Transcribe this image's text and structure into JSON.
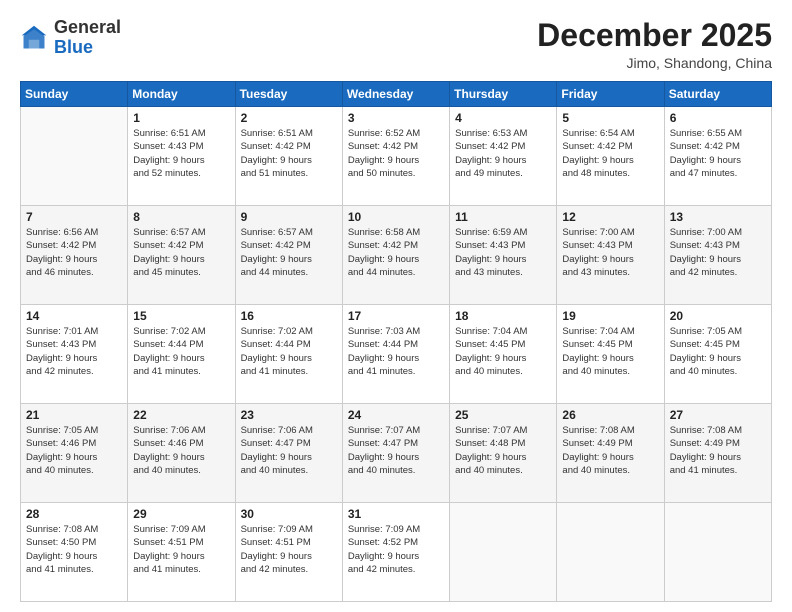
{
  "logo": {
    "general": "General",
    "blue": "Blue"
  },
  "header": {
    "month": "December 2025",
    "location": "Jimo, Shandong, China"
  },
  "weekdays": [
    "Sunday",
    "Monday",
    "Tuesday",
    "Wednesday",
    "Thursday",
    "Friday",
    "Saturday"
  ],
  "weeks": [
    [
      {
        "day": "",
        "info": ""
      },
      {
        "day": "1",
        "info": "Sunrise: 6:51 AM\nSunset: 4:43 PM\nDaylight: 9 hours\nand 52 minutes."
      },
      {
        "day": "2",
        "info": "Sunrise: 6:51 AM\nSunset: 4:42 PM\nDaylight: 9 hours\nand 51 minutes."
      },
      {
        "day": "3",
        "info": "Sunrise: 6:52 AM\nSunset: 4:42 PM\nDaylight: 9 hours\nand 50 minutes."
      },
      {
        "day": "4",
        "info": "Sunrise: 6:53 AM\nSunset: 4:42 PM\nDaylight: 9 hours\nand 49 minutes."
      },
      {
        "day": "5",
        "info": "Sunrise: 6:54 AM\nSunset: 4:42 PM\nDaylight: 9 hours\nand 48 minutes."
      },
      {
        "day": "6",
        "info": "Sunrise: 6:55 AM\nSunset: 4:42 PM\nDaylight: 9 hours\nand 47 minutes."
      }
    ],
    [
      {
        "day": "7",
        "info": "Sunrise: 6:56 AM\nSunset: 4:42 PM\nDaylight: 9 hours\nand 46 minutes."
      },
      {
        "day": "8",
        "info": "Sunrise: 6:57 AM\nSunset: 4:42 PM\nDaylight: 9 hours\nand 45 minutes."
      },
      {
        "day": "9",
        "info": "Sunrise: 6:57 AM\nSunset: 4:42 PM\nDaylight: 9 hours\nand 44 minutes."
      },
      {
        "day": "10",
        "info": "Sunrise: 6:58 AM\nSunset: 4:42 PM\nDaylight: 9 hours\nand 44 minutes."
      },
      {
        "day": "11",
        "info": "Sunrise: 6:59 AM\nSunset: 4:43 PM\nDaylight: 9 hours\nand 43 minutes."
      },
      {
        "day": "12",
        "info": "Sunrise: 7:00 AM\nSunset: 4:43 PM\nDaylight: 9 hours\nand 43 minutes."
      },
      {
        "day": "13",
        "info": "Sunrise: 7:00 AM\nSunset: 4:43 PM\nDaylight: 9 hours\nand 42 minutes."
      }
    ],
    [
      {
        "day": "14",
        "info": "Sunrise: 7:01 AM\nSunset: 4:43 PM\nDaylight: 9 hours\nand 42 minutes."
      },
      {
        "day": "15",
        "info": "Sunrise: 7:02 AM\nSunset: 4:44 PM\nDaylight: 9 hours\nand 41 minutes."
      },
      {
        "day": "16",
        "info": "Sunrise: 7:02 AM\nSunset: 4:44 PM\nDaylight: 9 hours\nand 41 minutes."
      },
      {
        "day": "17",
        "info": "Sunrise: 7:03 AM\nSunset: 4:44 PM\nDaylight: 9 hours\nand 41 minutes."
      },
      {
        "day": "18",
        "info": "Sunrise: 7:04 AM\nSunset: 4:45 PM\nDaylight: 9 hours\nand 40 minutes."
      },
      {
        "day": "19",
        "info": "Sunrise: 7:04 AM\nSunset: 4:45 PM\nDaylight: 9 hours\nand 40 minutes."
      },
      {
        "day": "20",
        "info": "Sunrise: 7:05 AM\nSunset: 4:45 PM\nDaylight: 9 hours\nand 40 minutes."
      }
    ],
    [
      {
        "day": "21",
        "info": "Sunrise: 7:05 AM\nSunset: 4:46 PM\nDaylight: 9 hours\nand 40 minutes."
      },
      {
        "day": "22",
        "info": "Sunrise: 7:06 AM\nSunset: 4:46 PM\nDaylight: 9 hours\nand 40 minutes."
      },
      {
        "day": "23",
        "info": "Sunrise: 7:06 AM\nSunset: 4:47 PM\nDaylight: 9 hours\nand 40 minutes."
      },
      {
        "day": "24",
        "info": "Sunrise: 7:07 AM\nSunset: 4:47 PM\nDaylight: 9 hours\nand 40 minutes."
      },
      {
        "day": "25",
        "info": "Sunrise: 7:07 AM\nSunset: 4:48 PM\nDaylight: 9 hours\nand 40 minutes."
      },
      {
        "day": "26",
        "info": "Sunrise: 7:08 AM\nSunset: 4:49 PM\nDaylight: 9 hours\nand 40 minutes."
      },
      {
        "day": "27",
        "info": "Sunrise: 7:08 AM\nSunset: 4:49 PM\nDaylight: 9 hours\nand 41 minutes."
      }
    ],
    [
      {
        "day": "28",
        "info": "Sunrise: 7:08 AM\nSunset: 4:50 PM\nDaylight: 9 hours\nand 41 minutes."
      },
      {
        "day": "29",
        "info": "Sunrise: 7:09 AM\nSunset: 4:51 PM\nDaylight: 9 hours\nand 41 minutes."
      },
      {
        "day": "30",
        "info": "Sunrise: 7:09 AM\nSunset: 4:51 PM\nDaylight: 9 hours\nand 42 minutes."
      },
      {
        "day": "31",
        "info": "Sunrise: 7:09 AM\nSunset: 4:52 PM\nDaylight: 9 hours\nand 42 minutes."
      },
      {
        "day": "",
        "info": ""
      },
      {
        "day": "",
        "info": ""
      },
      {
        "day": "",
        "info": ""
      }
    ]
  ]
}
